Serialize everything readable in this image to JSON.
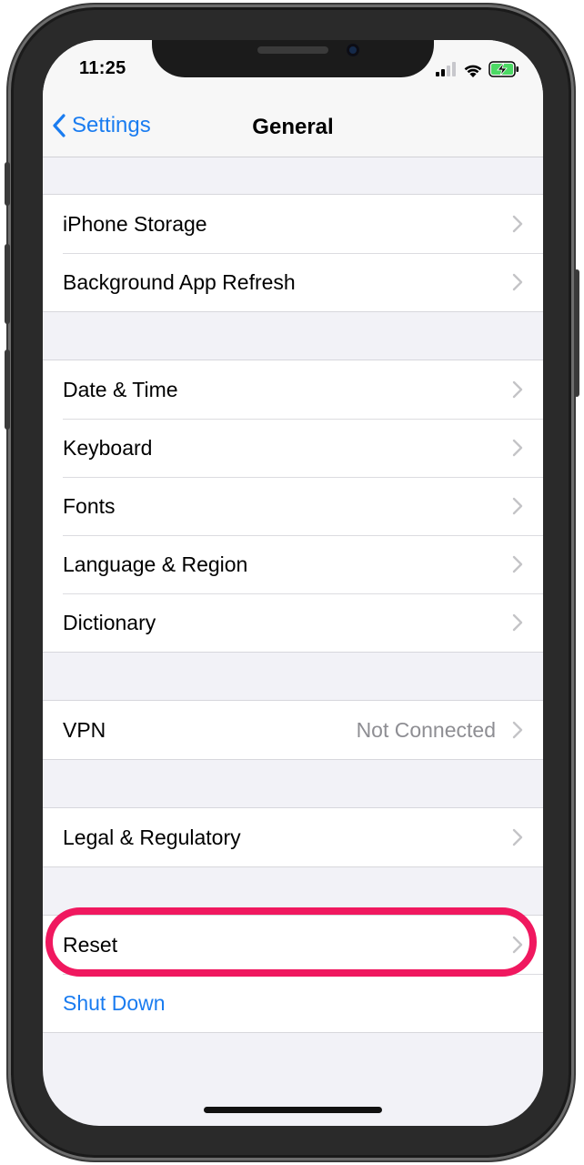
{
  "status_bar": {
    "time": "11:25",
    "icons": [
      "cellular-signal-icon",
      "wifi-icon",
      "battery-charging-icon"
    ]
  },
  "nav": {
    "back_label": "Settings",
    "title": "General"
  },
  "groups": [
    {
      "rows": [
        {
          "label": "iPhone Storage",
          "value": "",
          "chevron": true
        },
        {
          "label": "Background App Refresh",
          "value": "",
          "chevron": true
        }
      ]
    },
    {
      "rows": [
        {
          "label": "Date & Time",
          "value": "",
          "chevron": true
        },
        {
          "label": "Keyboard",
          "value": "",
          "chevron": true
        },
        {
          "label": "Fonts",
          "value": "",
          "chevron": true
        },
        {
          "label": "Language & Region",
          "value": "",
          "chevron": true
        },
        {
          "label": "Dictionary",
          "value": "",
          "chevron": true
        }
      ]
    },
    {
      "rows": [
        {
          "label": "VPN",
          "value": "Not Connected",
          "chevron": true
        }
      ]
    },
    {
      "rows": [
        {
          "label": "Legal & Regulatory",
          "value": "",
          "chevron": true
        }
      ]
    },
    {
      "rows": [
        {
          "label": "Reset",
          "value": "",
          "chevron": true
        },
        {
          "label": "Shut Down",
          "value": "",
          "chevron": false,
          "action": true
        }
      ]
    }
  ],
  "colors": {
    "accent": "#1a7cf0",
    "highlight": "#f0185f",
    "battery": "#4cd964",
    "background": "#f2f2f7"
  }
}
